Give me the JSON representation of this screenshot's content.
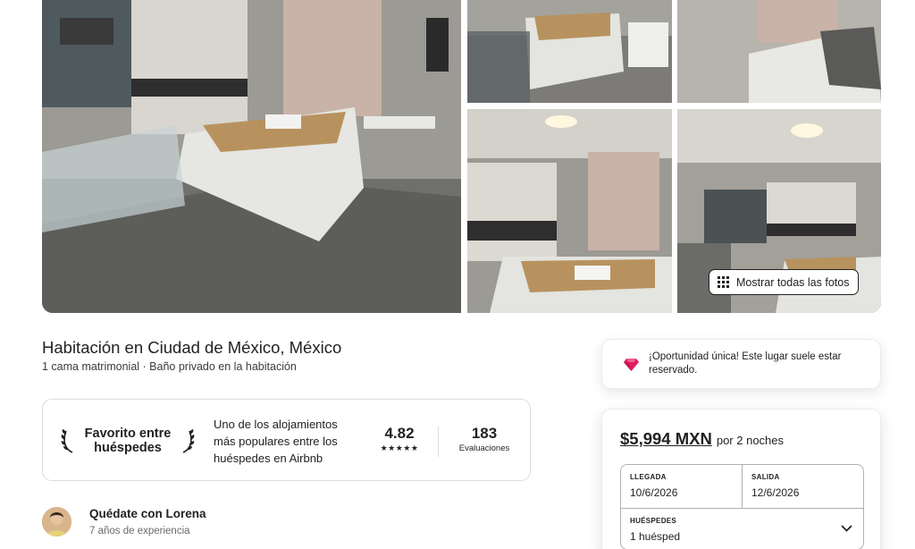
{
  "gallery": {
    "photos": [
      {
        "alt_icon": "bedroom-wide-photo"
      },
      {
        "alt_icon": "bedroom-top-photo"
      },
      {
        "alt_icon": "pillow-closeup-photo"
      },
      {
        "alt_icon": "bed-wall-art-photo"
      },
      {
        "alt_icon": "kitchenette-photo"
      }
    ],
    "show_all_label": "Mostrar todas las fotos"
  },
  "listing": {
    "title": "Habitación en Ciudad de México, México",
    "subtitle": "1 cama matrimonial · Baño privado en la habitación"
  },
  "guest_favorite": {
    "badge_line1": "Favorito entre",
    "badge_line2": "huéspedes",
    "description": "Uno de los alojamientos más populares entre los huéspedes en Airbnb",
    "rating": "4.82",
    "stars": "★★★★★",
    "reviews_count": "183",
    "reviews_label": "Evaluaciones"
  },
  "host": {
    "name": "Quédate con Lorena",
    "experience": "7 años de experiencia"
  },
  "rare_find": {
    "text": "¡Oportunidad única! Este lugar suele estar reservado.",
    "accent_color": "#E31C5F"
  },
  "booking": {
    "price": "$5,994 MXN",
    "price_unit": "por 2 noches",
    "checkin_label": "LLEGADA",
    "checkin_value": "10/6/2026",
    "checkout_label": "SALIDA",
    "checkout_value": "12/6/2026",
    "guests_label": "HUÉSPEDES",
    "guests_value": "1 huésped"
  }
}
